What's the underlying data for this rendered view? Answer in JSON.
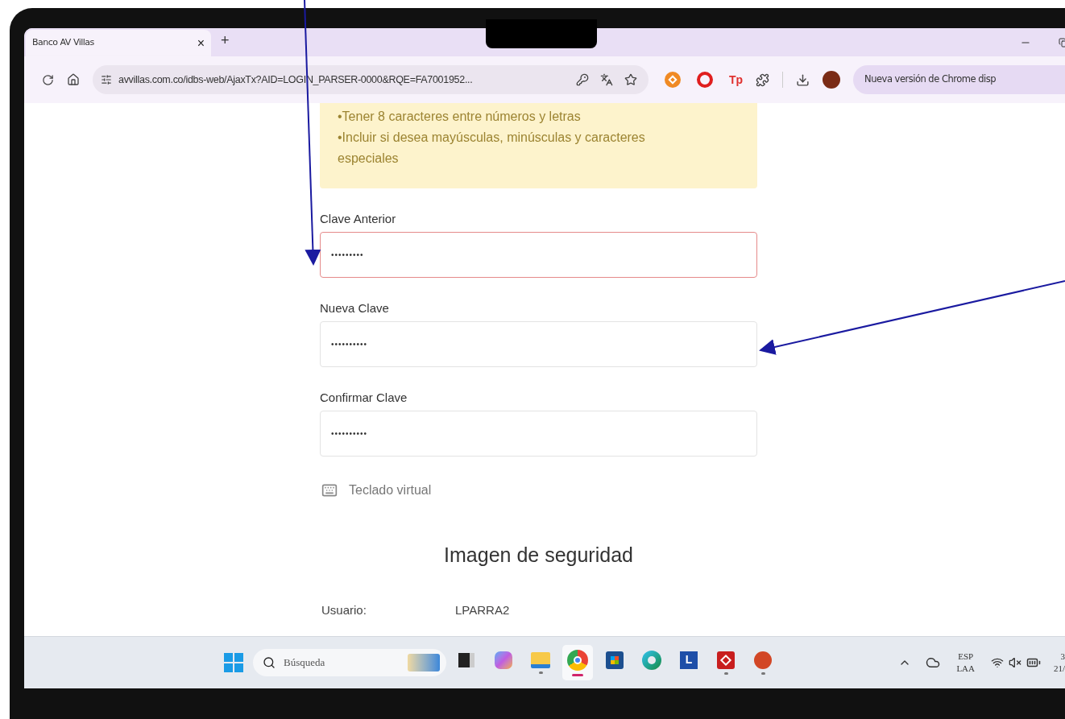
{
  "browser": {
    "tab": {
      "title": "Banco AV Villas",
      "close": "×",
      "selected": true
    },
    "new_tab": "+",
    "url": "avvillas.com.co/idbs-web/AjaxTx?AID=LOGIN_PARSER-0000&RQE=FA7001952...",
    "extensions": [
      {
        "kind": "orange"
      },
      {
        "kind": "opera"
      },
      {
        "kind": "tp",
        "label": "Tp"
      }
    ],
    "update_button": "Nueva versión de Chrome disp"
  },
  "notice": {
    "lines": [
      "•Tener 8 caracteres entre números y letras",
      "•Incluir si desea mayúsculas, minúsculas y caracteres especiales"
    ]
  },
  "form": {
    "fields": [
      {
        "label": "Clave Anterior",
        "value": "•••••••••",
        "invalid": true
      },
      {
        "label": "Nueva Clave",
        "value": "••••••••••",
        "invalid": false
      },
      {
        "label": "Confirmar Clave",
        "value": "••••••••••",
        "invalid": false
      }
    ]
  },
  "virtual_keyboard": "Teclado virtual",
  "security": {
    "heading": "Imagen de seguridad",
    "user_label": "Usuario:",
    "user_value": "LPARRA2"
  },
  "taskbar": {
    "search_placeholder": "Búsqueda",
    "apps": [
      {
        "kind": "task",
        "running": false,
        "selected": false
      },
      {
        "kind": "copilot",
        "running": false,
        "selected": false
      },
      {
        "kind": "folder",
        "running": true,
        "selected": false
      },
      {
        "kind": "chrome",
        "running": true,
        "selected": true
      },
      {
        "kind": "store",
        "running": false,
        "selected": false
      },
      {
        "kind": "edge",
        "running": false,
        "selected": false
      },
      {
        "kind": "letter",
        "label": "L",
        "running": false,
        "selected": false
      },
      {
        "kind": "pdf",
        "running": true,
        "selected": false
      },
      {
        "kind": "powerpoint",
        "running": true,
        "selected": false
      }
    ],
    "language": [
      "ESP",
      "LAA"
    ],
    "time": "3",
    "date": "21/"
  }
}
